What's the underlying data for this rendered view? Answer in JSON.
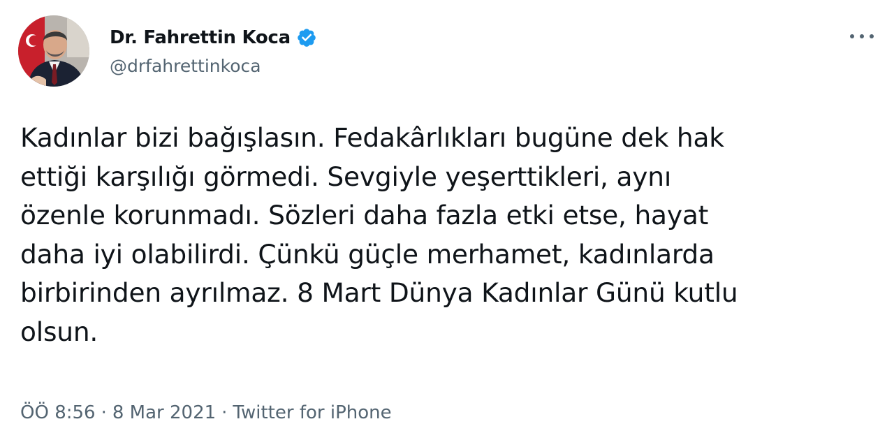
{
  "author": {
    "display_name": "Dr. Fahrettin Koca",
    "handle": "@drfahrettinkoca",
    "verified_icon": "verified-badge-icon"
  },
  "tweet": {
    "text": "Kadınlar bizi bağışlasın. Fedakârlıkları bugüne dek hak\nettiği karşılığı görmedi. Sevgiyle yeşerttikleri, aynı\nözenle korunmadı. Sözleri daha fazla etki etse, hayat\ndaha iyi olabilirdi. Çünkü güçle merhamet, kadınlarda\nbirbirinden ayrılmaz. 8 Mart Dünya Kadınlar Günü kutlu\nolsun.",
    "time": "ÖÖ 8:56",
    "date": "8 Mar 2021",
    "separator": "·",
    "source": "Twitter for iPhone"
  },
  "icons": {
    "more": "more-options-icon"
  },
  "colors": {
    "verified_blue": "#1d9bf0",
    "text_primary": "#0f1419",
    "text_secondary": "#536471"
  }
}
